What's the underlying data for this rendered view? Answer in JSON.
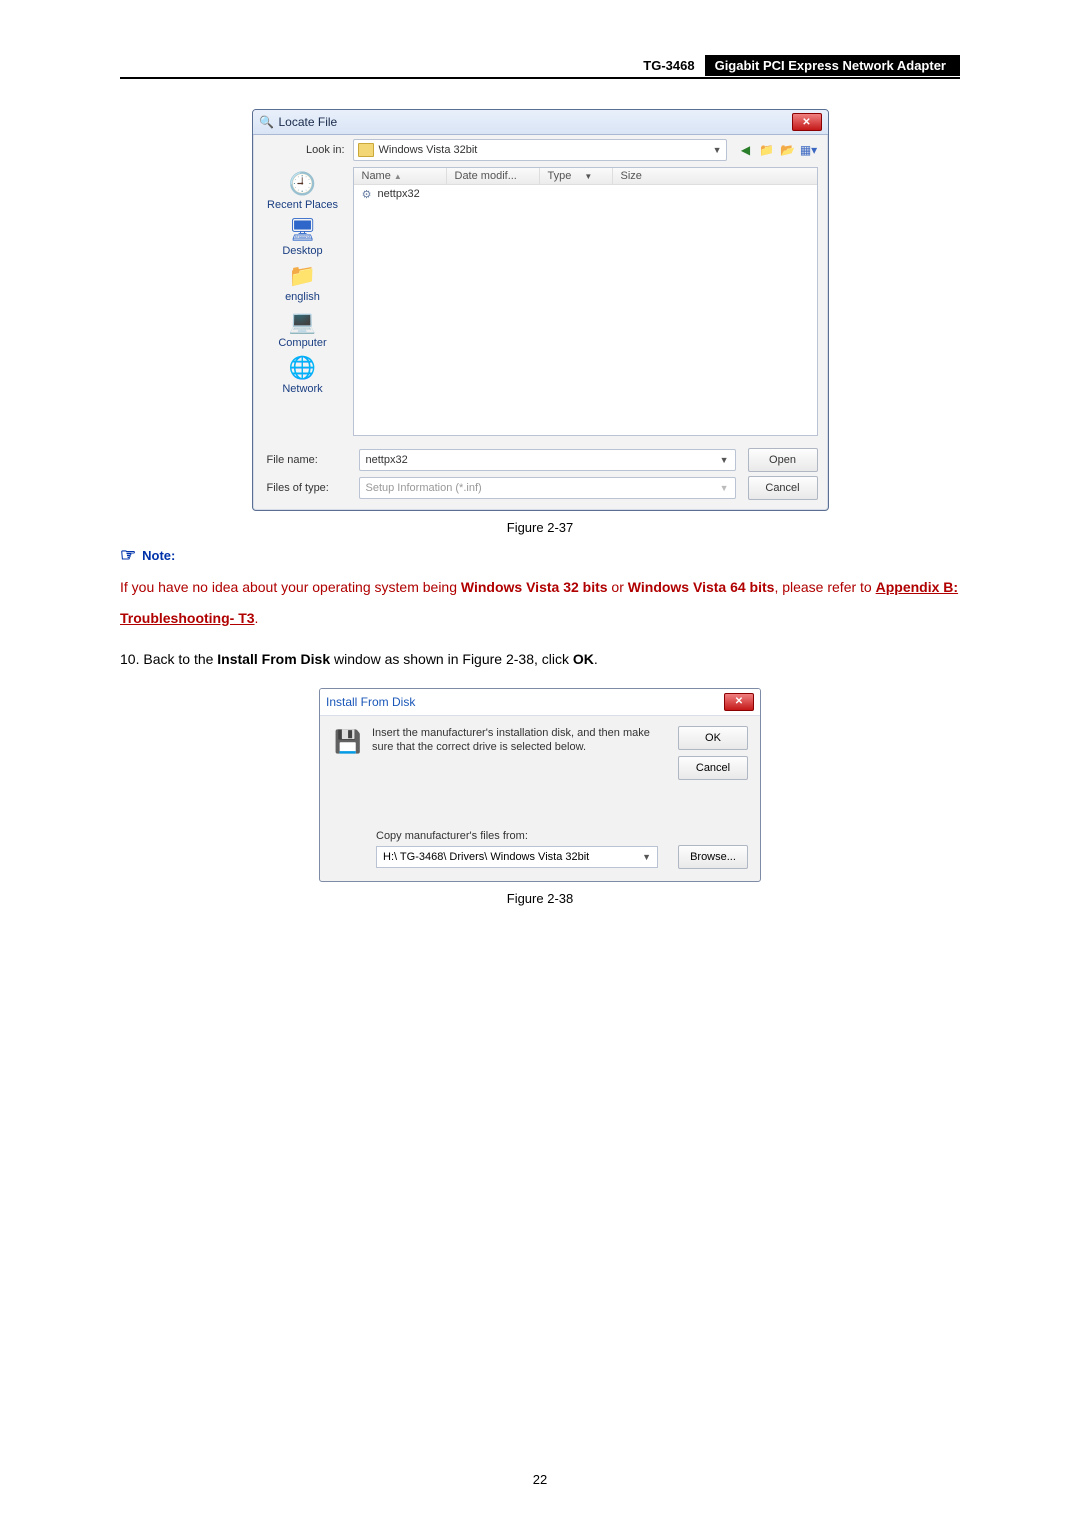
{
  "header": {
    "model": "TG-3468",
    "product": "Gigabit PCI Express Network Adapter"
  },
  "locate_dialog": {
    "title": "Locate File",
    "look_in_label": "Look in:",
    "look_in_value": "Windows Vista 32bit",
    "columns": {
      "name": "Name",
      "date": "Date modif...",
      "type": "Type",
      "size": "Size"
    },
    "file_row": "nettpx32",
    "places": {
      "recent": "Recent Places",
      "desktop": "Desktop",
      "user": "english",
      "computer": "Computer",
      "network": "Network"
    },
    "file_name_label": "File name:",
    "file_name_value": "nettpx32",
    "files_of_type_label": "Files of type:",
    "files_of_type_value": "Setup Information (*.inf)",
    "open_label": "Open",
    "cancel_label": "Cancel"
  },
  "fig1_caption": "Figure 2-37",
  "note": {
    "heading": "Note:",
    "part1": "If you have no idea about your operating system being ",
    "bold1": "Windows Vista 32 bits",
    "or": " or ",
    "bold2": "Windows Vista 64 bits",
    "part2": ", please refer to ",
    "appendix": "Appendix B: Troubleshooting- T3",
    "period": "."
  },
  "step10": {
    "num": "10.  ",
    "a": "Back to the ",
    "b": "Install From Disk",
    "c": " window as shown in Figure 2-38, click ",
    "ok": "OK",
    "d": "."
  },
  "install_dialog": {
    "title": "Install From Disk",
    "message": "Insert the manufacturer's installation disk, and then make sure that the correct drive is selected below.",
    "ok_label": "OK",
    "cancel_label": "Cancel",
    "copy_label": "Copy manufacturer's files from:",
    "path_value": "H:\\ TG-3468\\ Drivers\\ Windows Vista 32bit",
    "browse_label": "Browse..."
  },
  "fig2_caption": "Figure 2-38",
  "page_number": "22"
}
